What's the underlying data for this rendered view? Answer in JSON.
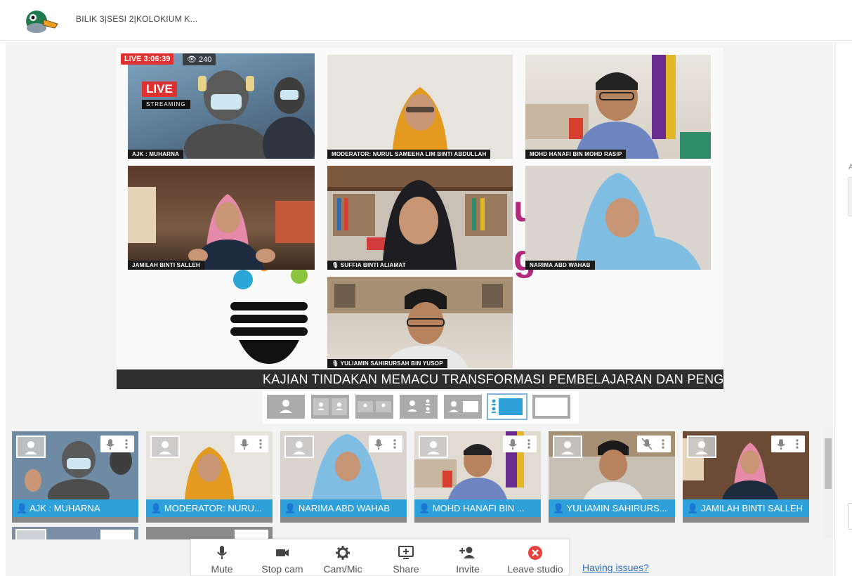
{
  "header": {
    "title": "BILIK 3|SESI 2|KOLOKIUM K..."
  },
  "stage": {
    "live_badge": "LIVE 3:06:39",
    "viewers": "240",
    "live_logo_top": "LIVE",
    "live_logo_bottom": "STREAMING",
    "tiles": [
      {
        "label": "AJK : MUHARNA"
      },
      {
        "label": "MODERATOR: NURUL SAMEEHA LIM BINTI ABDULLAH"
      },
      {
        "label": "MOHD HANAFI BIN MOHD RASIP"
      },
      {
        "label": "JAMILAH BINTI SALLEH"
      },
      {
        "label": "SUFFIA BINTI ALIAMAT"
      },
      {
        "label": "NARIMA ABD WAHAB"
      },
      {
        "label": "YULIAMIN SAHIRURSAH BIN YUSOP"
      }
    ],
    "ticker": "KAJIAN TINDAKAN MEMACU TRANSFORMASI PEMBELAJARAN DAN PENGAJ"
  },
  "participants": [
    {
      "name": "AJK : MUHARNA",
      "mic": "on"
    },
    {
      "name": "MODERATOR: NURU...",
      "mic": "on"
    },
    {
      "name": "NARIMA ABD WAHAB",
      "mic": "on"
    },
    {
      "name": "MOHD HANAFI BIN ...",
      "mic": "on"
    },
    {
      "name": "YULIAMIN SAHIRURS...",
      "mic": "muted"
    },
    {
      "name": "JAMILAH BINTI SALLEH",
      "mic": "on"
    }
  ],
  "toolbar": {
    "mute": "Mute",
    "stop_cam": "Stop cam",
    "cam_mic": "Cam/Mic",
    "share": "Share",
    "invite": "Invite",
    "leave": "Leave studio"
  },
  "links": {
    "having_issues": "Having issues?"
  },
  "colors": {
    "accent_blue": "#2ea0da",
    "live_red": "#e03131",
    "leave_red": "#e8423f",
    "ticker_bg": "#2e2e2e"
  }
}
